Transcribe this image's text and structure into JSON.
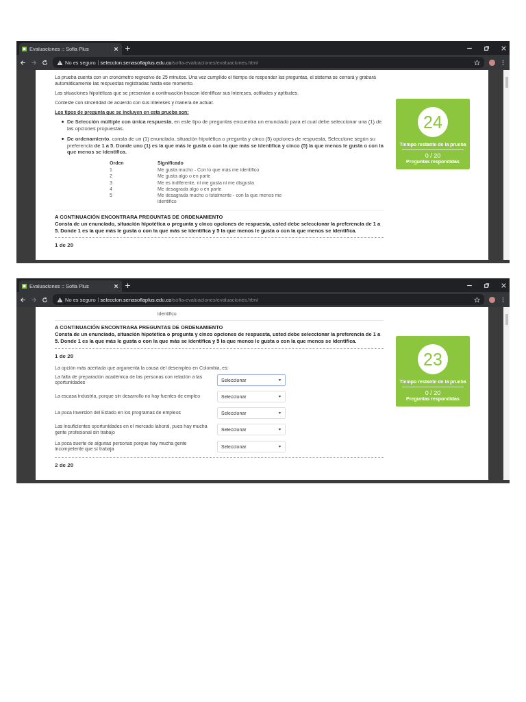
{
  "screenshots": [
    {
      "tab_title": "Evaluaciones :: Sofia Plus",
      "security_label": "No es seguro",
      "url_host": "seleccion.senasofiaplus.edu.co",
      "url_path": "/sofia-evaluaciones/evaluaciones.html",
      "timer": {
        "value": "24",
        "label": "Tiempo restante de la prueba",
        "count": "0 / 20",
        "count_label": "Preguntas respondidas"
      },
      "blocks": [
        {
          "kind": "text",
          "text": "La prueba cuenta con un cronómetro regresivo de 25 minutos. Una vez cumplido el tiempo de responder las preguntas, el sistema se cerrará y grabará automáticamente las respuestas registradas hasta ese momento."
        },
        {
          "kind": "text",
          "text": "Las situaciones hipotéticas que se presentan a continuación buscan identificar sus intereses, actitudes y aptitudes."
        },
        {
          "kind": "text",
          "text": "Conteste con sinceridad de acuerdo con sus intereses y manera de actuar."
        },
        {
          "kind": "underline",
          "text": "Los tipos de pregunta que se incluyen en esta prueba son:"
        },
        {
          "kind": "bullets",
          "items": [
            "**De Selección múltiple con única respuesta**, en este tipo de preguntas encuentra un enunciado para el cual debe seleccionar una (1) de las opciones propuestas.",
            "**De ordenamiento**, consta de un (1) enunciado, situación hipotética o pregunta y cinco (5) opciones de respuesta, Seleccione según su preferencia **de 1 a 5. Donde  uno (1) es la que más le gusta o con la que más se identifica y cinco (5) la que menos le gusta o con la que menos se identifica.**"
          ]
        },
        {
          "kind": "order_table",
          "columns": [
            "Orden",
            "Significado"
          ],
          "rows": [
            [
              "1",
              "Me gusta mucho - Con lo que más me identifico"
            ],
            [
              "2",
              "Me gusta algo o en parte"
            ],
            [
              "3",
              "Me es indiferente, ni me gusta ni me disgusta"
            ],
            [
              "4",
              "Me desagrada algo o en parte"
            ],
            [
              "5",
              "Me desagrada mucho o totalmente - con la que menos me identifico"
            ]
          ]
        },
        {
          "kind": "rule"
        },
        {
          "kind": "notice",
          "title": "A CONTINUACIÓN ENCONTRARA PREGUNTAS DE ORDENAMIENTO",
          "body": "Consta de un enunciado, situación hipotética o pregunta y cinco opciones de respuesta,  usted debe seleccionar la preferencia  de 1 a 5.  Donde  1 es la que más le gusta o con la que más se identifica y 5 la que menos le gusta o con la que menos se identifica."
        },
        {
          "kind": "dashed"
        },
        {
          "kind": "counter",
          "text": "1 de 20"
        }
      ]
    },
    {
      "tab_title": "Evaluaciones :: Sofia Plus",
      "security_label": "No es seguro",
      "url_host": "seleccion.senasofiaplus.edu.co",
      "url_path": "/sofia-evaluaciones/evaluaciones.html",
      "timer": {
        "value": "23",
        "label": "Tiempo restante de la prueba",
        "count": "0 / 20",
        "count_label": "Preguntas respondidas"
      },
      "blocks": [
        {
          "kind": "fragment",
          "text": "identifico"
        },
        {
          "kind": "rule"
        },
        {
          "kind": "notice",
          "title": "A CONTINUACIÓN ENCONTRARA PREGUNTAS DE ORDENAMIENTO",
          "body": "Consta de un enunciado, situación hipotética o pregunta y cinco opciones de respuesta,  usted debe seleccionar la preferencia  de 1 a 5.  Donde  1 es la que más le gusta o con la que más se identifica y 5 la que menos le gusta o con la que menos se identifica."
        },
        {
          "kind": "dashed"
        },
        {
          "kind": "counter",
          "text": "1 de 20"
        },
        {
          "kind": "question",
          "prompt": "La opción más acertada que argumenta la causa del desempleo en Colombia, es:",
          "options": [
            {
              "text": "La falta de preparación académica de las personas con relación a las oportunidades",
              "value": "Seleccionar",
              "focused": true
            },
            {
              "text": "La escasa industria, porque sin desarrollo no hay fuentes de empleo",
              "value": "Seleccionar",
              "focused": false
            },
            {
              "text": "La poca inversión del Estado en los programas de empleos",
              "value": "Seleccionar",
              "focused": false
            },
            {
              "text": "Las insuficientes oportunidades en el mercado laboral, pues hay mucha gente profesional sin trabajo",
              "value": "Seleccionar",
              "focused": false
            },
            {
              "text": "La poca suerte de algunas personas porque hay mucha gente incompetente que sí trabaja",
              "value": "Seleccionar",
              "focused": false
            }
          ]
        },
        {
          "kind": "dashed"
        },
        {
          "kind": "counter",
          "text": "2 de 20"
        }
      ]
    }
  ]
}
